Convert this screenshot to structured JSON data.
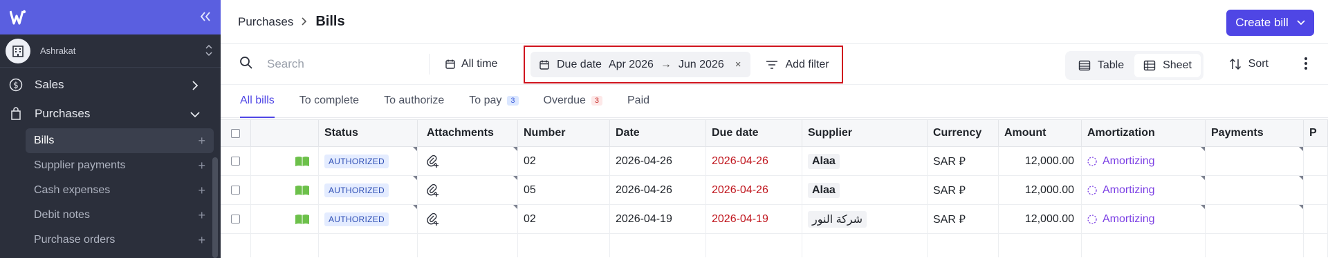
{
  "sidebar": {
    "org_name": "Ashrakat",
    "nav": [
      {
        "label": "Sales"
      },
      {
        "label": "Purchases"
      }
    ],
    "sub_items": [
      {
        "label": "Bills",
        "plus": "+"
      },
      {
        "label": "Supplier payments",
        "plus": "+"
      },
      {
        "label": "Cash expenses",
        "plus": "+"
      },
      {
        "label": "Debit notes",
        "plus": "+"
      },
      {
        "label": "Purchase orders",
        "plus": "+"
      }
    ]
  },
  "header": {
    "breadcrumb": "Purchases",
    "title": "Bills",
    "create_label": "Create bill"
  },
  "toolbar": {
    "search_placeholder": "Search",
    "all_time": "All time",
    "filter_label": "Due date",
    "filter_from": "Apr 2026",
    "filter_arrow": "→",
    "filter_to": "Jun 2026",
    "filter_clear": "×",
    "add_filter": "Add filter",
    "view_table": "Table",
    "view_sheet": "Sheet",
    "sort": "Sort"
  },
  "tabs": [
    {
      "label": "All bills",
      "badge": ""
    },
    {
      "label": "To complete",
      "badge": ""
    },
    {
      "label": "To authorize",
      "badge": ""
    },
    {
      "label": "To pay",
      "badge": "3"
    },
    {
      "label": "Overdue",
      "badge": "3"
    },
    {
      "label": "Paid",
      "badge": ""
    }
  ],
  "table": {
    "columns": [
      "Status",
      "Attachments",
      "Number",
      "Date",
      "Due date",
      "Supplier",
      "Currency",
      "Amount",
      "Amortization",
      "Payments",
      "P"
    ],
    "rows": [
      {
        "status": "AUTHORIZED",
        "number": "02",
        "date": "2026-04-26",
        "due": "2026-04-26",
        "supplier": "Alaa",
        "currency": "SAR ⃁",
        "amount": "12,000.00",
        "amortization": "Amortizing"
      },
      {
        "status": "AUTHORIZED",
        "number": "05",
        "date": "2026-04-26",
        "due": "2026-04-26",
        "supplier": "Alaa",
        "currency": "SAR ⃁",
        "amount": "12,000.00",
        "amortization": "Amortizing"
      },
      {
        "status": "AUTHORIZED",
        "number": "02",
        "date": "2026-04-19",
        "due": "2026-04-19",
        "supplier": "شركة النور",
        "currency": "SAR ⃁",
        "amount": "12,000.00",
        "amortization": "Amortizing"
      }
    ]
  },
  "colors": {
    "accent": "#4f46e5",
    "sidebar_bg": "#2b2f3b",
    "sidebar_top": "#5a5fe0",
    "due_red": "#c0161e",
    "amortizing": "#7b3fe4",
    "highlight_box": "#d0141e"
  },
  "icons": [
    "logo-icon",
    "collapse-icon",
    "building-icon",
    "chevron-updown-icon",
    "dollar-circle-icon",
    "bag-icon",
    "search-icon",
    "calendar-icon",
    "filter-lines-icon",
    "table-icon",
    "sheet-icon",
    "sort-icon",
    "more-vertical-icon",
    "book-icon",
    "attachment-add-icon",
    "spinner-icon"
  ]
}
